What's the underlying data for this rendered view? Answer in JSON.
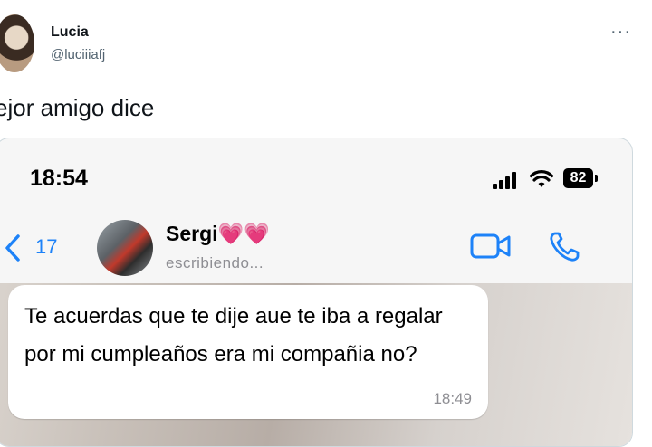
{
  "tweet": {
    "user_name": "Lucia",
    "user_handle": "@luciiiafj",
    "more_label": "···",
    "text": "ejor amigo dice"
  },
  "phone": {
    "status_time": "18:54",
    "battery": "82",
    "back_count": "17",
    "contact_name": "Sergi💗💗",
    "contact_status": "escribiendo...",
    "message": {
      "text": "Te acuerdas que te dije aue te iba a regalar por mi cumpleaños era mi compañia no?",
      "time": "18:49"
    }
  },
  "colors": {
    "ios_blue": "#1d82f8",
    "bubble": "#ffffff",
    "muted": "#8e8e93"
  }
}
